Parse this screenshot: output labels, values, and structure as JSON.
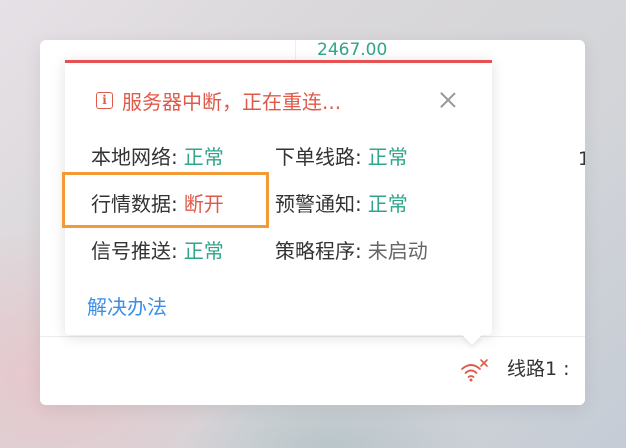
{
  "background_window": {
    "price": "2467.00",
    "side_digit": "1",
    "line_status": "线路1 :"
  },
  "popup": {
    "title": "服务器中断，正在重连...",
    "info_icon": "info-icon",
    "close_icon": "close-icon",
    "status_items": [
      {
        "label": "本地网络:",
        "value": "正常",
        "state": "ok"
      },
      {
        "label": "下单线路:",
        "value": "正常",
        "state": "ok"
      },
      {
        "label": "行情数据:",
        "value": "断开",
        "state": "bad"
      },
      {
        "label": "预警通知:",
        "value": "正常",
        "state": "ok"
      },
      {
        "label": "信号推送:",
        "value": "正常",
        "state": "ok"
      },
      {
        "label": "策略程序:",
        "value": "未启动",
        "state": "inactive"
      }
    ],
    "solution_link": "解决办法"
  },
  "colors": {
    "ok": "#2fa58a",
    "bad": "#e05a4a",
    "inactive": "#666666",
    "link": "#3e8ee6",
    "highlight": "#f29a35"
  },
  "icons": {
    "wifi_disconnected": "wifi-disconnected-icon"
  }
}
